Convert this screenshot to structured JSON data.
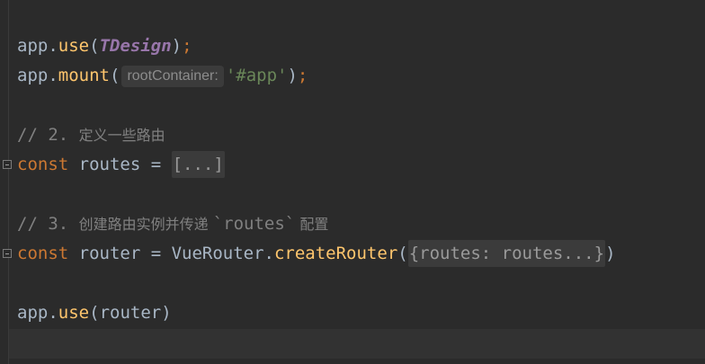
{
  "code": {
    "line1": {
      "obj": "app",
      "dot": ".",
      "method": "use",
      "open": "(",
      "arg": "TDesign",
      "close": ")",
      "semi": ";"
    },
    "line2": {
      "obj": "app",
      "dot": ".",
      "method": "mount",
      "open": "(",
      "hint": "rootContainer:",
      "arg": "'#app'",
      "close": ")",
      "semi": ";"
    },
    "line4": {
      "text_a": "// 2. ",
      "text_b": "定义一些路由"
    },
    "line5": {
      "kw": "const",
      "rest": " routes = ",
      "folded": "[...]"
    },
    "line7": {
      "text_a": "// 3. ",
      "text_b": "创建路由实例并传递 ",
      "text_c": "`routes`",
      "text_d": " 配置"
    },
    "line8": {
      "kw": "const",
      "name": " router = VueRouter.",
      "method": "createRouter",
      "open": "(",
      "folded": "{routes: routes...}",
      "close": ")"
    },
    "line10": {
      "obj": "app",
      "dot": ".",
      "method": "use",
      "open": "(",
      "arg": "router",
      "close": ")"
    }
  }
}
